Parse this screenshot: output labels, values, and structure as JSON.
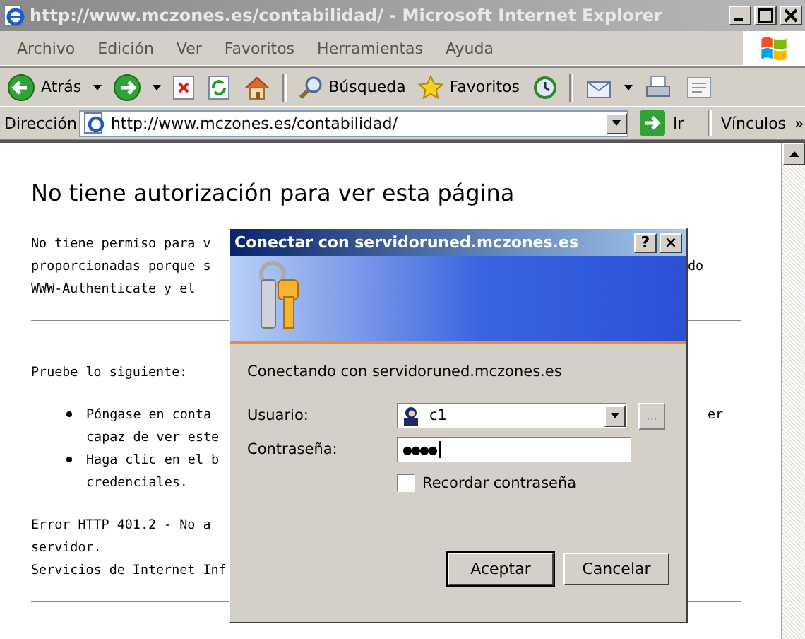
{
  "window": {
    "title": "http://www.mczones.es/contabilidad/ - Microsoft Internet Explorer"
  },
  "menu": [
    "Archivo",
    "Edición",
    "Ver",
    "Favoritos",
    "Herramientas",
    "Ayuda"
  ],
  "toolbar": [
    {
      "kind": "back",
      "label": "Atrás"
    },
    {
      "kind": "forward"
    },
    {
      "kind": "stop"
    },
    {
      "kind": "refresh"
    },
    {
      "kind": "home"
    },
    {
      "kind": "separator"
    },
    {
      "kind": "search",
      "label": "Búsqueda"
    },
    {
      "kind": "favorites",
      "label": "Favoritos"
    },
    {
      "kind": "history"
    },
    {
      "kind": "separator"
    },
    {
      "kind": "mail"
    },
    {
      "kind": "print"
    },
    {
      "kind": "edit"
    }
  ],
  "address_bar": {
    "label": "Dirección",
    "url": "http://www.mczones.es/contabilidad/",
    "go": "Ir",
    "links": "Vínculos",
    "more": "»"
  },
  "page": {
    "heading": "No tiene autorización para ver esta página",
    "blocks": [
      {
        "kind": "text",
        "lines": [
          {
            "left": "No tiene permiso para v"
          },
          {
            "left": "proporcionadas porque s",
            "right": "do"
          },
          {
            "left": "WWW-Authenticate y el"
          }
        ]
      },
      {
        "kind": "rule"
      },
      {
        "kind": "text",
        "lines": [
          {
            "left": "Pruebe lo siguiente:"
          }
        ]
      },
      {
        "kind": "bullets",
        "items": [
          {
            "lines": [
              {
                "left": "Póngase en conta",
                "right": "er"
              },
              {
                "left": "capaz de ver este"
              }
            ]
          },
          {
            "lines": [
              {
                "left": "Haga clic en el b"
              },
              {
                "left": "credenciales."
              }
            ]
          }
        ]
      },
      {
        "kind": "text",
        "lines": [
          {
            "left": "Error HTTP 401.2 - No a"
          },
          {
            "left": "servidor."
          },
          {
            "left": "Servicios de Internet Inf"
          }
        ]
      },
      {
        "kind": "rule"
      }
    ]
  },
  "dialog": {
    "title": "Conectar con servidoruned.mczones.es",
    "help": "?",
    "close": "×",
    "message": "Conectando con servidoruned.mczones.es",
    "user_label": "Usuario:",
    "user_value": "c1",
    "browse": "...",
    "password_label": "Contraseña:",
    "password_value": "●●●●",
    "remember": {
      "label": "Recordar contraseña",
      "checked": false
    },
    "buttons": [
      {
        "label": "Aceptar",
        "selected": true
      },
      {
        "label": "Cancelar",
        "selected": false
      }
    ]
  }
}
